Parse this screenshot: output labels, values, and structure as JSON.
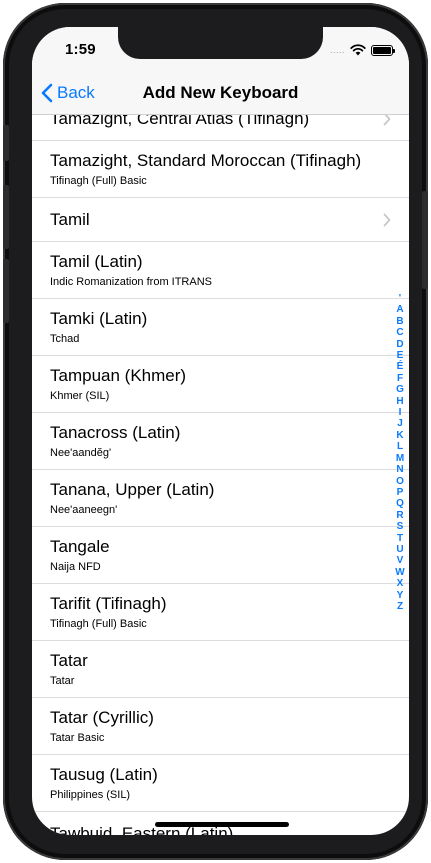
{
  "status": {
    "time": "1:59",
    "carrier_dots": "....."
  },
  "nav": {
    "back_label": "Back",
    "title": "Add New Keyboard"
  },
  "rows": [
    {
      "title": "Tamazight, Central Atlas (Tifinagh)",
      "subtitle": "",
      "chevron": true
    },
    {
      "title": "Tamazight, Standard Moroccan (Tifinagh)",
      "subtitle": "Tifinagh (Full) Basic",
      "chevron": false
    },
    {
      "title": "Tamil",
      "subtitle": "",
      "chevron": true
    },
    {
      "title": "Tamil (Latin)",
      "subtitle": "Indic Romanization from ITRANS",
      "chevron": false
    },
    {
      "title": "Tamki (Latin)",
      "subtitle": "Tchad",
      "chevron": false
    },
    {
      "title": "Tampuan (Khmer)",
      "subtitle": "Khmer (SIL)",
      "chevron": false
    },
    {
      "title": "Tanacross (Latin)",
      "subtitle": "Nee'aandĕg'",
      "chevron": false
    },
    {
      "title": "Tanana, Upper (Latin)",
      "subtitle": "Nee'aaneegn'",
      "chevron": false
    },
    {
      "title": "Tangale",
      "subtitle": "Naija NFD",
      "chevron": false
    },
    {
      "title": "Tarifit (Tifinagh)",
      "subtitle": "Tifinagh (Full) Basic",
      "chevron": false
    },
    {
      "title": "Tatar",
      "subtitle": "Tatar",
      "chevron": false
    },
    {
      "title": "Tatar (Cyrillic)",
      "subtitle": "Tatar Basic",
      "chevron": false
    },
    {
      "title": "Tausug (Latin)",
      "subtitle": "Philippines (SIL)",
      "chevron": false
    },
    {
      "title": "Tawbuid, Eastern (Latin)",
      "subtitle": "",
      "chevron": false
    }
  ],
  "index_letters": [
    "'",
    "A",
    "B",
    "C",
    "D",
    "E",
    "É",
    "F",
    "G",
    "H",
    "I",
    "J",
    "K",
    "L",
    "M",
    "N",
    "O",
    "P",
    "Q",
    "R",
    "S",
    "T",
    "U",
    "V",
    "W",
    "X",
    "Y",
    "Z"
  ],
  "colors": {
    "accent": "#0a7aff",
    "chevron": "#c7c7cc",
    "bar": "#f7f7f7"
  }
}
